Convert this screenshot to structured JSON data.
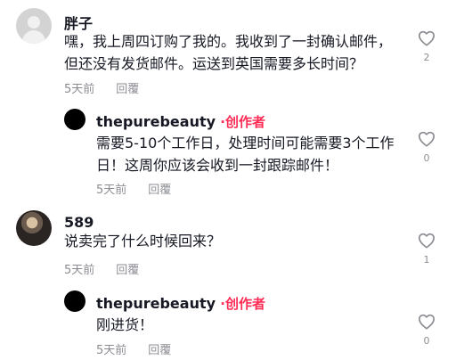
{
  "comments": [
    {
      "username": "胖子",
      "text_lines": [
        "嘿，我上周四订购了我的。我收到了一封确认邮件，",
        "但还没有发货邮件。运送到英国需要多长时间？"
      ],
      "time": "5天前",
      "reply_label": "回覆",
      "likes": "2",
      "avatar": "default-avatar"
    },
    {
      "username": "thepurebeauty",
      "creator_dot": "·",
      "creator_label": "创作者",
      "text_lines": [
        "需要5-10个工作日，处理时间可能需要3个工作",
        "日！这周你应该会收到一封跟踪邮件！"
      ],
      "time": "5天前",
      "reply_label": "回覆",
      "likes": "0",
      "avatar": "black-avatar"
    },
    {
      "username": "589",
      "text_lines": [
        "说卖完了什么时候回来？"
      ],
      "time": "5天前",
      "reply_label": "回覆",
      "likes": "1",
      "avatar": "photo-avatar"
    },
    {
      "username": "thepurebeauty",
      "creator_dot": "·",
      "creator_label": "创作者",
      "text_lines": [
        "刚进货！"
      ],
      "time": "5天前",
      "reply_label": "回覆",
      "likes": "0",
      "avatar": "black-avatar"
    }
  ],
  "icons": {
    "like": "heart-outline-icon"
  },
  "colors": {
    "creator": "#fe2c55",
    "text": "#161823",
    "meta": "#8a8b91"
  }
}
